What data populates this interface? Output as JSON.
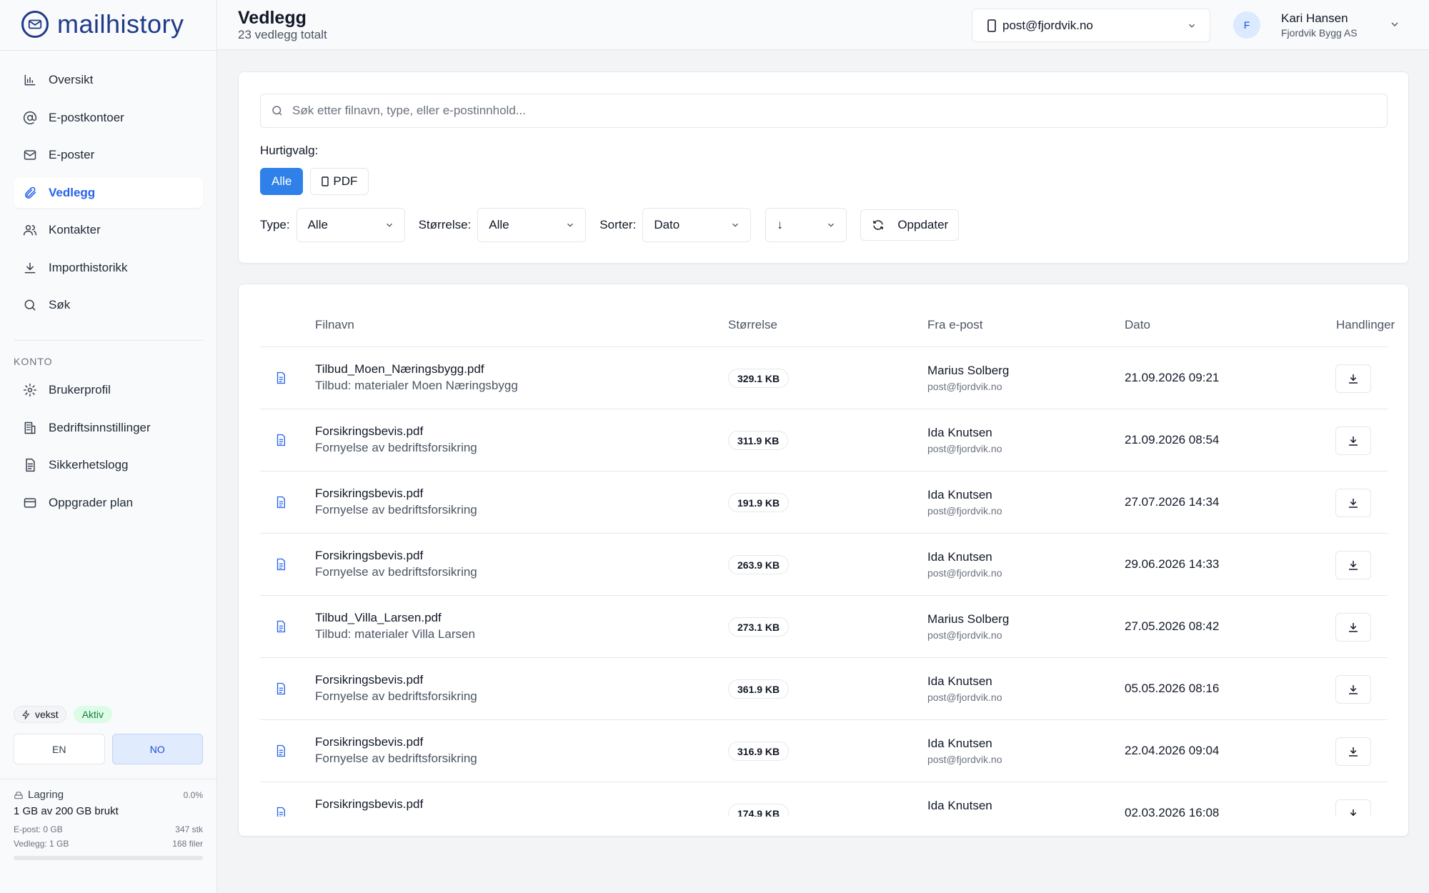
{
  "app": {
    "name": "mailhistory"
  },
  "sidebar": {
    "nav": [
      {
        "label": "Oversikt",
        "icon": "bar-chart-icon",
        "active": false
      },
      {
        "label": "E-postkontoer",
        "icon": "at-sign-icon",
        "active": false
      },
      {
        "label": "E-poster",
        "icon": "mail-icon",
        "active": false
      },
      {
        "label": "Vedlegg",
        "icon": "paperclip-icon",
        "active": true
      },
      {
        "label": "Kontakter",
        "icon": "users-icon",
        "active": false
      },
      {
        "label": "Importhistorikk",
        "icon": "download-icon",
        "active": false
      },
      {
        "label": "Søk",
        "icon": "search-icon",
        "active": false
      }
    ],
    "account_section_label": "KONTO",
    "account_nav": [
      {
        "label": "Brukerprofil",
        "icon": "gear-icon"
      },
      {
        "label": "Bedriftsinnstillinger",
        "icon": "building-icon"
      },
      {
        "label": "Sikkerhetslogg",
        "icon": "document-icon"
      },
      {
        "label": "Oppgrader plan",
        "icon": "credit-card-icon"
      }
    ],
    "plan_badge": "vekst",
    "status_badge": "Aktiv",
    "languages": [
      {
        "label": "EN",
        "active": false
      },
      {
        "label": "NO",
        "active": true
      }
    ],
    "storage": {
      "title": "Lagring",
      "percent": "0.0%",
      "used": "1 GB av 200 GB brukt",
      "email_label": "E-post: 0 GB",
      "email_count": "347 stk",
      "attach_label": "Vedlegg: 1 GB",
      "attach_count": "168 filer",
      "fill_fraction": 0.0
    }
  },
  "header": {
    "title": "Vedlegg",
    "subtitle": "23 vedlegg totalt",
    "account": "post@fjordvik.no",
    "user": {
      "initial": "F",
      "name": "Kari Hansen",
      "org": "Fjordvik Bygg AS"
    }
  },
  "filters": {
    "search_placeholder": "Søk etter filnavn, type, eller e-postinnhold...",
    "quick_label": "Hurtigvalg:",
    "quick": [
      {
        "label": "Alle",
        "active": true
      },
      {
        "label": "PDF",
        "active": false
      }
    ],
    "type_label": "Type:",
    "type_value": "Alle",
    "size_label": "Størrelse:",
    "size_value": "Alle",
    "sort_label": "Sorter:",
    "sort_value": "Dato",
    "order_value": "↓",
    "refresh_label": "Oppdater"
  },
  "table": {
    "columns": {
      "filename": "Filnavn",
      "size": "Størrelse",
      "from": "Fra e-post",
      "date": "Dato",
      "actions": "Handlinger"
    },
    "rows": [
      {
        "name": "Tilbud_Moen_Næringsbygg.pdf",
        "subject": "Tilbud: materialer Moen Næringsbygg",
        "size": "329.1 KB",
        "sender": "Marius Solberg",
        "email": "post@fjordvik.no",
        "date": "21.09.2026 09:21"
      },
      {
        "name": "Forsikringsbevis.pdf",
        "subject": "Fornyelse av bedriftsforsikring",
        "size": "311.9 KB",
        "sender": "Ida Knutsen",
        "email": "post@fjordvik.no",
        "date": "21.09.2026 08:54"
      },
      {
        "name": "Forsikringsbevis.pdf",
        "subject": "Fornyelse av bedriftsforsikring",
        "size": "191.9 KB",
        "sender": "Ida Knutsen",
        "email": "post@fjordvik.no",
        "date": "27.07.2026 14:34"
      },
      {
        "name": "Forsikringsbevis.pdf",
        "subject": "Fornyelse av bedriftsforsikring",
        "size": "263.9 KB",
        "sender": "Ida Knutsen",
        "email": "post@fjordvik.no",
        "date": "29.06.2026 14:33"
      },
      {
        "name": "Tilbud_Villa_Larsen.pdf",
        "subject": "Tilbud: materialer Villa Larsen",
        "size": "273.1 KB",
        "sender": "Marius Solberg",
        "email": "post@fjordvik.no",
        "date": "27.05.2026 08:42"
      },
      {
        "name": "Forsikringsbevis.pdf",
        "subject": "Fornyelse av bedriftsforsikring",
        "size": "361.9 KB",
        "sender": "Ida Knutsen",
        "email": "post@fjordvik.no",
        "date": "05.05.2026 08:16"
      },
      {
        "name": "Forsikringsbevis.pdf",
        "subject": "Fornyelse av bedriftsforsikring",
        "size": "316.9 KB",
        "sender": "Ida Knutsen",
        "email": "post@fjordvik.no",
        "date": "22.04.2026 09:04"
      },
      {
        "name": "Forsikringsbevis.pdf",
        "subject": "",
        "size": "174.9 KB",
        "sender": "Ida Knutsen",
        "email": "",
        "date": "02.03.2026 16:08"
      }
    ]
  }
}
